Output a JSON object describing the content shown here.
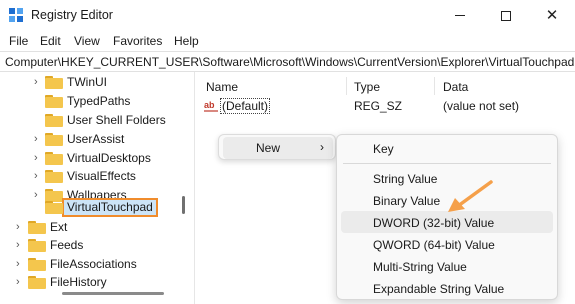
{
  "window": {
    "title": "Registry Editor",
    "controls": {
      "minimize": "—",
      "maximize": "▢",
      "close": "✕"
    }
  },
  "menu": [
    "File",
    "Edit",
    "View",
    "Favorites",
    "Help"
  ],
  "address": "Computer\\HKEY_CURRENT_USER\\Software\\Microsoft\\Windows\\CurrentVersion\\Explorer\\VirtualTouchpad",
  "tree": [
    {
      "label": "TWinUI",
      "expander": "›"
    },
    {
      "label": "TypedPaths",
      "expander": ""
    },
    {
      "label": "User Shell Folders",
      "expander": ""
    },
    {
      "label": "UserAssist",
      "expander": "›"
    },
    {
      "label": "VirtualDesktops",
      "expander": "›"
    },
    {
      "label": "VisualEffects",
      "expander": "›"
    },
    {
      "label": "Wallpapers",
      "expander": "›"
    },
    {
      "label": "VirtualTouchpad",
      "expander": "",
      "selected": true
    },
    {
      "label": "Ext",
      "expander": "›"
    },
    {
      "label": "Feeds",
      "expander": "›"
    },
    {
      "label": "FileAssociations",
      "expander": "›"
    },
    {
      "label": "FileHistory",
      "expander": "›"
    }
  ],
  "columns": {
    "name": "Name",
    "type": "Type",
    "data": "Data"
  },
  "values": [
    {
      "icon": "ab",
      "name": "(Default)",
      "type": "REG_SZ",
      "data": "(value not set)"
    }
  ],
  "context_menu": {
    "new_label": "New",
    "new_arrow": "›",
    "submenu": {
      "key": "Key",
      "string": "String Value",
      "binary": "Binary Value",
      "dword": "DWORD (32-bit) Value",
      "qword": "QWORD (64-bit) Value",
      "multi_string": "Multi-String Value",
      "expandable": "Expandable String Value"
    }
  },
  "colors": {
    "selection_fill": "#cce4f7",
    "highlight_border": "#f08c2c",
    "callout_arrow": "#f5a04a",
    "folder": "#f4c64d"
  },
  "icons": {
    "app": "registry-editor-icon",
    "folder": "folder-icon",
    "string_value": "string-value-icon",
    "callout": "callout-arrow-icon"
  }
}
